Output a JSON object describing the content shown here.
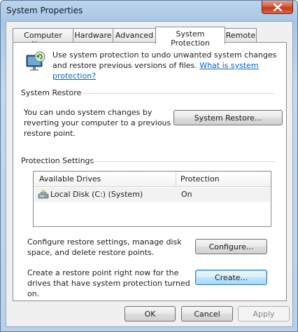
{
  "window": {
    "title": "System Properties"
  },
  "tabs": [
    {
      "label": "Computer Name"
    },
    {
      "label": "Hardware"
    },
    {
      "label": "Advanced"
    },
    {
      "label": "System Protection"
    },
    {
      "label": "Remote"
    }
  ],
  "active_tab": "System Protection",
  "intro": {
    "text": "Use system protection to undo unwanted system changes and restore previous versions of files.",
    "link": "What is system protection?"
  },
  "system_restore": {
    "group_title": "System Restore",
    "description": "You can undo system changes by reverting your computer to a previous restore point.",
    "button": "System Restore..."
  },
  "protection_settings": {
    "group_title": "Protection Settings",
    "columns": [
      "Available Drives",
      "Protection"
    ],
    "rows": [
      {
        "drive": "Local Disk (C:) (System)",
        "protection": "On",
        "icon": "drive-icon"
      }
    ],
    "configure_text": "Configure restore settings, manage disk space, and delete restore points.",
    "configure_button": "Configure...",
    "create_text": "Create a restore point right now for the drives that have system protection turned on.",
    "create_button": "Create..."
  },
  "footer": {
    "ok": "OK",
    "cancel": "Cancel",
    "apply": "Apply"
  }
}
